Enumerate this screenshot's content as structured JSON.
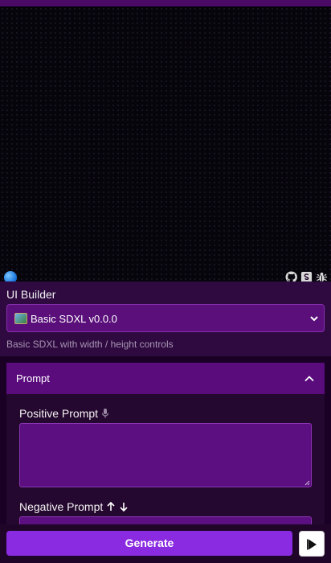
{
  "canvas": {
    "footer_icons": [
      "github-icon",
      "s-box-icon",
      "bug-icon"
    ],
    "status_icon": "blue-dot-icon"
  },
  "builder": {
    "label": "UI Builder",
    "selected_option": "Basic SDXL v0.0.0",
    "selected_icon": "picture-frame-icon",
    "description": "Basic SDXL with width / height controls"
  },
  "prompt_panel": {
    "title": "Prompt",
    "positive_label": "Positive Prompt",
    "positive_value": "",
    "negative_label": "Negative Prompt",
    "negative_value": ""
  },
  "actions": {
    "generate_label": "Generate",
    "play_icon": "play-icon"
  },
  "colors": {
    "accent": "#8a2be2",
    "panel_header": "#5a0c7d",
    "background": "#1a0025"
  }
}
